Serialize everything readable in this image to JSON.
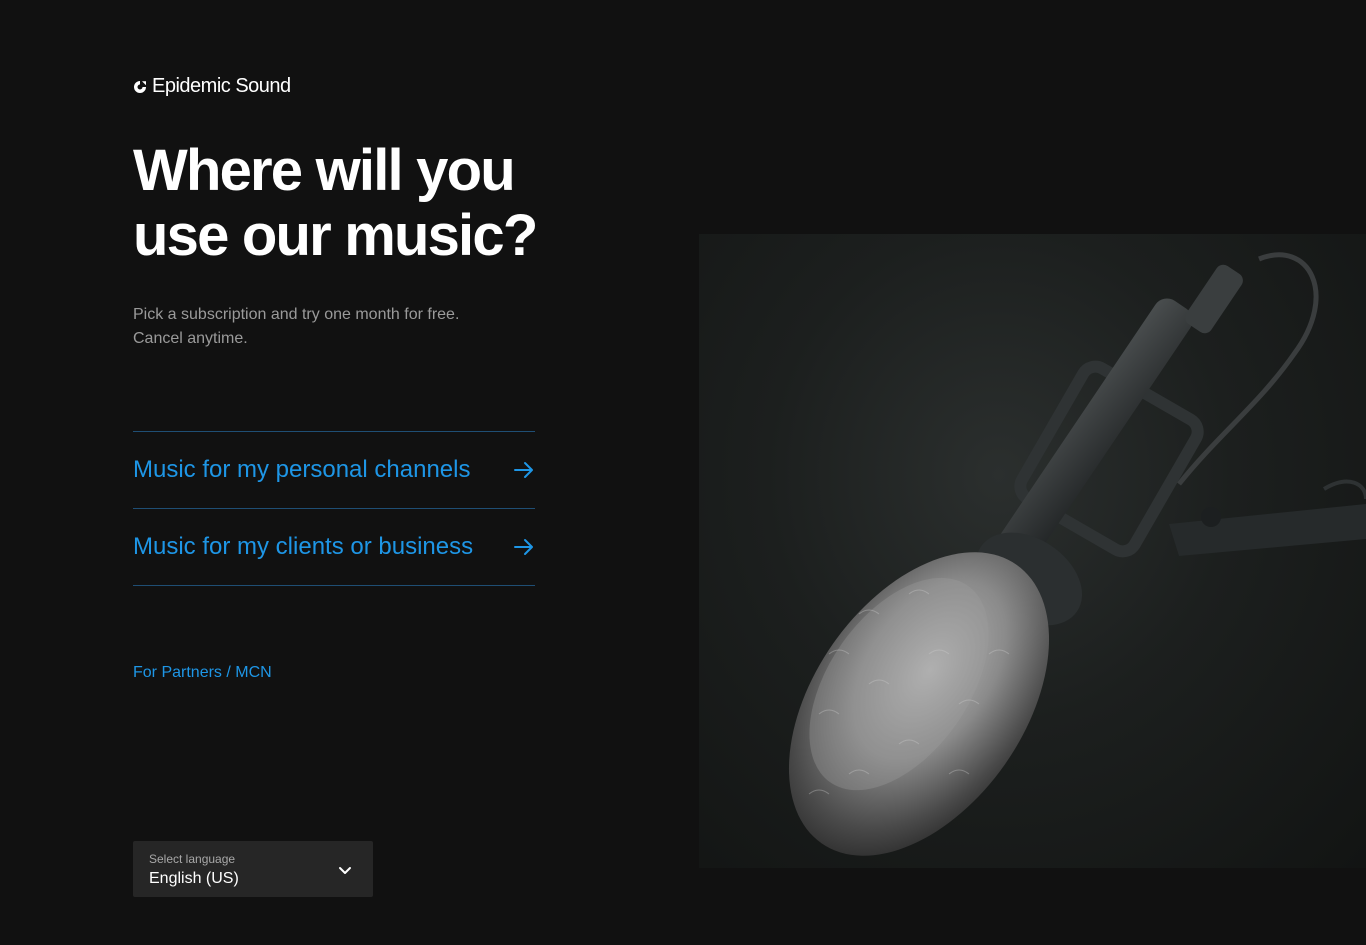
{
  "brand": {
    "name": "Epidemic Sound"
  },
  "headline": {
    "line1": "Where will you",
    "line2": "use our music?"
  },
  "subtext": {
    "line1": "Pick a subscription and try one month for free.",
    "line2": "Cancel anytime."
  },
  "options": [
    {
      "label": "Music for my personal channels",
      "icon": "arrow-right-icon"
    },
    {
      "label": "Music for my clients or business",
      "icon": "arrow-right-icon"
    }
  ],
  "partners_link": {
    "label": "For Partners / MCN"
  },
  "language_select": {
    "label": "Select language",
    "value": "English (US)",
    "icon": "chevron-down-icon"
  },
  "hero_image": {
    "subject": "shotgun-microphone-with-fur-windscreen"
  },
  "colors": {
    "background": "#111111",
    "accent": "#1e96e6",
    "divider": "#1f4e74",
    "muted_text": "#9a9a9a",
    "select_bg": "#262626"
  }
}
